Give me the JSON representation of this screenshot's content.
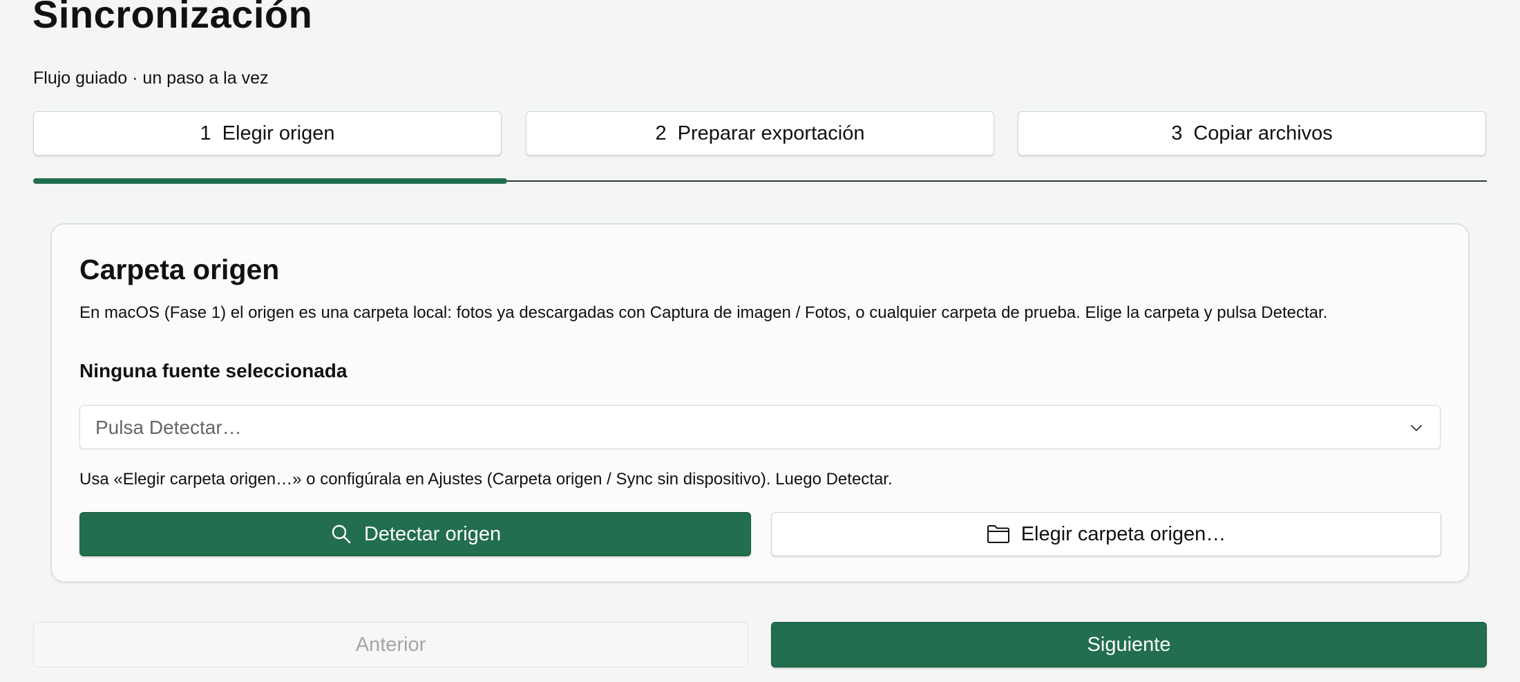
{
  "header": {
    "title": "Sincronización",
    "subtitle": "Flujo guiado · un paso a la vez"
  },
  "steps": [
    {
      "number": "1",
      "label": "Elegir origen",
      "active": true
    },
    {
      "number": "2",
      "label": "Preparar exportación",
      "active": false
    },
    {
      "number": "3",
      "label": "Copiar archivos",
      "active": false
    }
  ],
  "progress": {
    "current_step": 1,
    "total_steps": 3,
    "fraction": 0.3333
  },
  "source_card": {
    "title": "Carpeta origen",
    "description": "En macOS (Fase 1) el origen es una carpeta local: fotos ya descargadas con Captura de imagen / Fotos, o cualquier carpeta de prueba. Elige la carpeta y pulsa Detectar.",
    "status": "Ninguna fuente seleccionada",
    "select": {
      "value": "Pulsa Detectar…",
      "icon": "chevron-down-icon"
    },
    "hint": "Usa «Elegir carpeta origen…» o configúrala en Ajustes (Carpeta origen / Sync sin dispositivo). Luego Detectar.",
    "detect_button": {
      "label": "Detectar origen",
      "icon": "search-icon"
    },
    "choose_button": {
      "label": "Elegir carpeta origen…",
      "icon": "folder-icon"
    }
  },
  "navigation": {
    "prev_label": "Anterior",
    "prev_enabled": false,
    "next_label": "Siguiente"
  },
  "colors": {
    "accent": "#226e4f",
    "background": "#f4f6f5",
    "disabled_text": "#a3a6a4"
  }
}
